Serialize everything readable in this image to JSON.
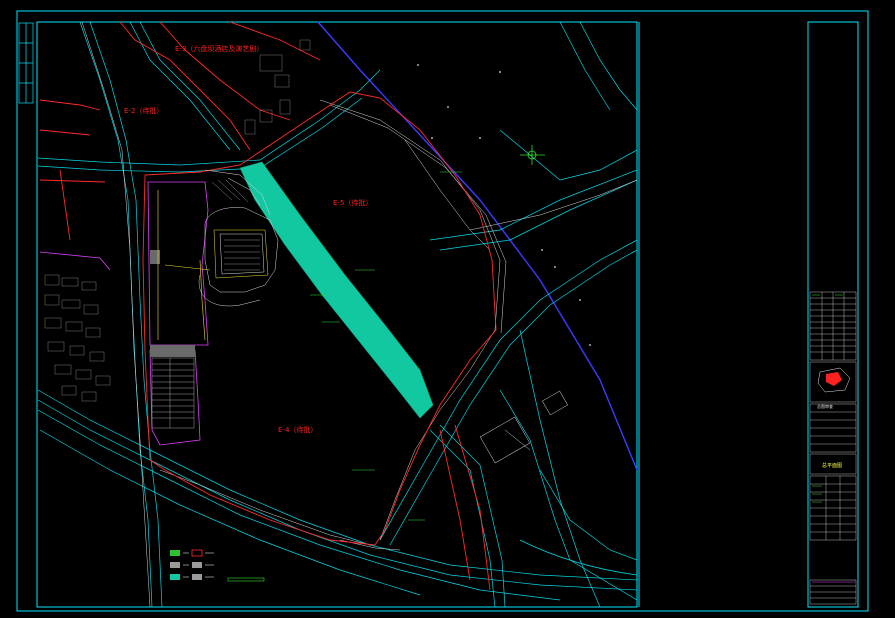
{
  "plan": {
    "zone_labels": [
      {
        "id": "E-3",
        "text": "E-3（六盘坝酒店及演艺剧）"
      },
      {
        "id": "E-2",
        "text": "E-2（待批）"
      },
      {
        "id": "E-5",
        "text": "E-5（待批）"
      },
      {
        "id": "E-4",
        "text": "E-4（待批）"
      }
    ]
  },
  "colors": {
    "background": "#000000",
    "frame": "#00e5ff",
    "red_line": "#ff2a2a",
    "road_cyan": "#00d8e8",
    "road_blue": "#3b3bff",
    "green_belt": "#12c8a0",
    "magenta": "#e040ff",
    "yellow": "#f0e020",
    "white": "#e8e8e8"
  },
  "title_block": {
    "stamp_label": "总图审查",
    "sheet_title": "总平面图"
  }
}
